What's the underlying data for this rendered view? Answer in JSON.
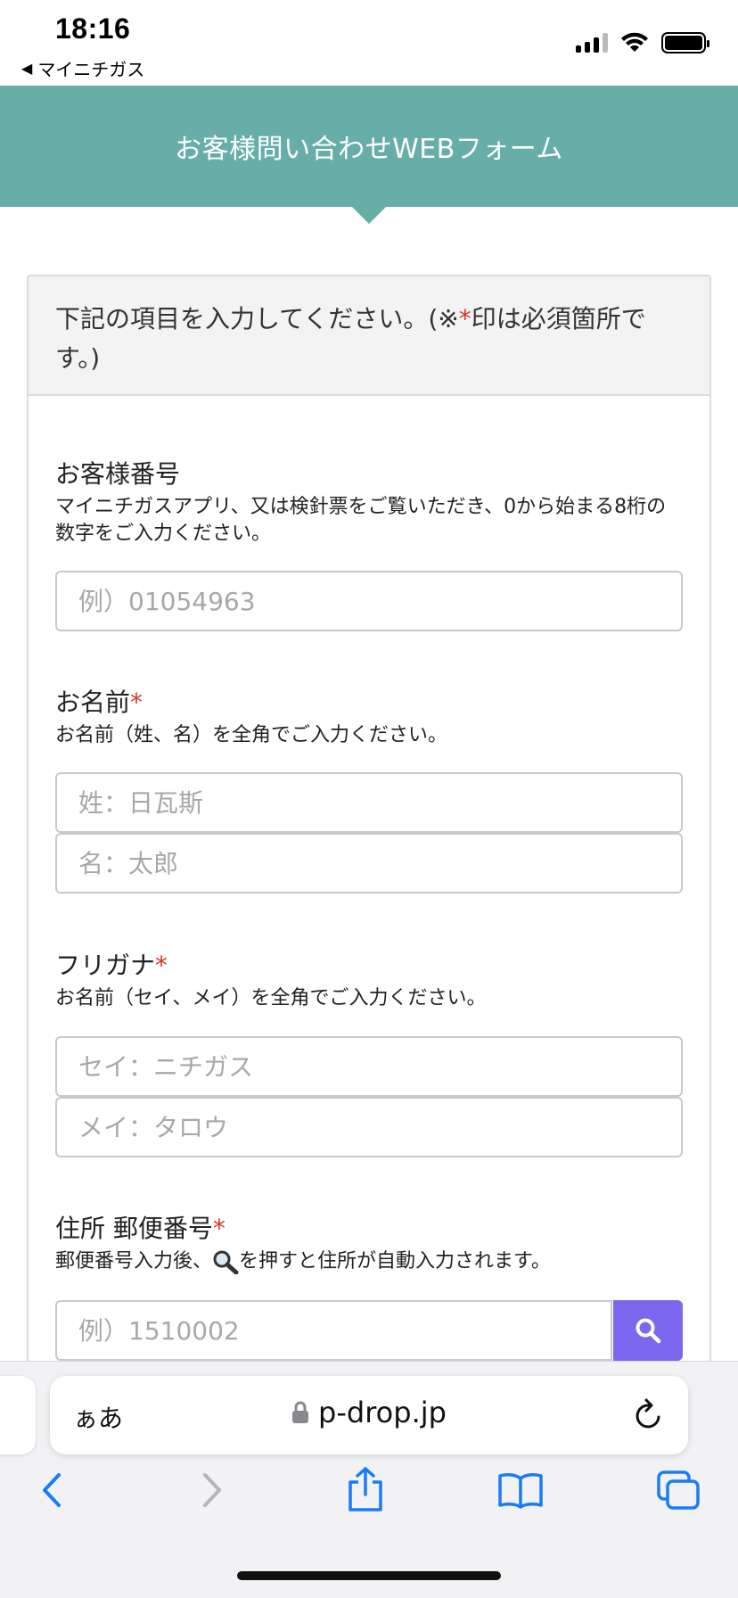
{
  "status_bar": {
    "time": "18:16",
    "back_app_label": "マイニチガス",
    "signal_icon": "signal-icon",
    "wifi_icon": "wifi-icon",
    "battery_icon": "battery-icon"
  },
  "header": {
    "title": "お客様問い合わせWEBフォーム"
  },
  "form": {
    "instruction_part1": "下記の項目を入力してください。(※",
    "instruction_required_mark": "*",
    "instruction_part2": "印は必須箇所です。)",
    "customer_number": {
      "label": "お客様番号",
      "help": "マイニチガスアプリ、又は検針票をご覧いただき、0から始まる8桁の数字をご入力ください。",
      "placeholder": "例）01054963"
    },
    "name": {
      "label": "お名前",
      "required_mark": "*",
      "help": "お名前（姓、名）を全角でご入力ください。",
      "last_placeholder": "姓：日瓦斯",
      "first_placeholder": "名：太郎"
    },
    "furigana": {
      "label": "フリガナ",
      "required_mark": "*",
      "help": "お名前（セイ、メイ）を全角でご入力ください。",
      "last_placeholder": "セイ：ニチガス",
      "first_placeholder": "メイ：タロウ"
    },
    "postal": {
      "label": "住所 郵便番号",
      "required_mark": "*",
      "help_before": "郵便番号入力後、",
      "help_after": "を押すと住所が自動入力されます。",
      "placeholder": "例）1510002",
      "search_icon": "search-icon"
    }
  },
  "colors": {
    "header_bg": "#67aea9",
    "required_mark": "#d9342b",
    "search_button": "#7b68ee",
    "safari_icon_blue": "#1a7cf5"
  },
  "browser": {
    "aa_label": "ぁあ",
    "url": "p-drop.jp",
    "lock_icon": "lock-icon",
    "reload_icon": "reload-icon",
    "toolbar": [
      "back-icon",
      "forward-icon",
      "share-icon",
      "bookmarks-icon",
      "tabs-icon"
    ]
  }
}
